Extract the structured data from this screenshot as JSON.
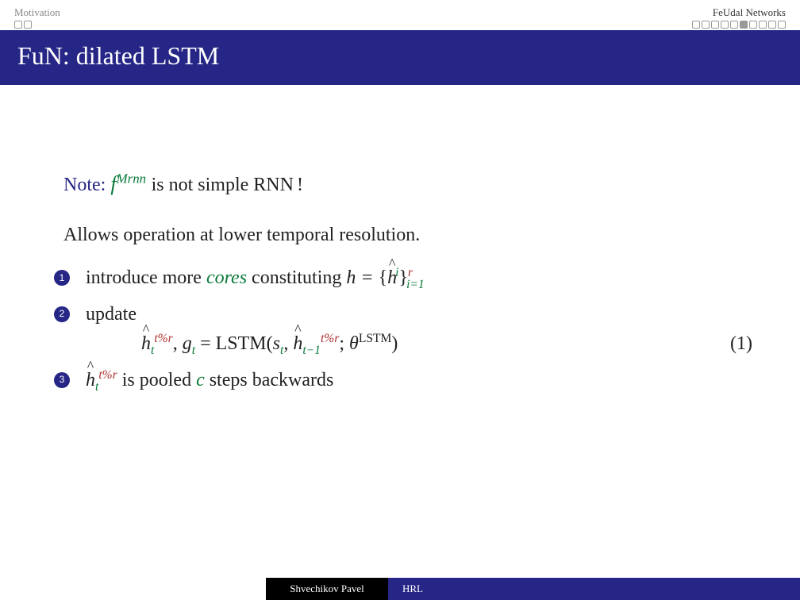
{
  "header": {
    "left_section": "Motivation",
    "right_section": "FeUdal Networks",
    "left_dots": {
      "total": 2,
      "active": -1
    },
    "right_dots": {
      "total": 10,
      "active": 5
    }
  },
  "title": "FuN: dilated LSTM",
  "body": {
    "note_label": "Note:",
    "note_f": "f",
    "note_sup": "Mrnn",
    "note_rest": " is not simple RNN",
    "excl": "!",
    "allows": "Allows operation at lower temporal resolution.",
    "item1_a": "introduce more ",
    "item1_cores": "cores",
    "item1_b": " constituting ",
    "item2_a": "update",
    "item3_b": " is pooled ",
    "item3_c": "c",
    "item3_d": " steps backwards",
    "eq_num": "(1)"
  },
  "math": {
    "h_eq": "h = ",
    "brace_l": "{",
    "brace_r": "}",
    "hat_h": "h",
    "i_sup": "i",
    "r_sup": "r",
    "i_eq1": "i=1",
    "tmod": "t%r",
    "t_sub": "t",
    "tm1": "t−1",
    "comma_g": ",  ",
    "g": "g",
    "eq_lstm": " = LSTM(",
    "s": "s",
    "sc": ", ",
    "scolon": "; ",
    "theta": "θ",
    "lstm_sup": "LSTM",
    "close": ")"
  },
  "footer": {
    "author": "Shvechikov Pavel",
    "short": "HRL"
  }
}
